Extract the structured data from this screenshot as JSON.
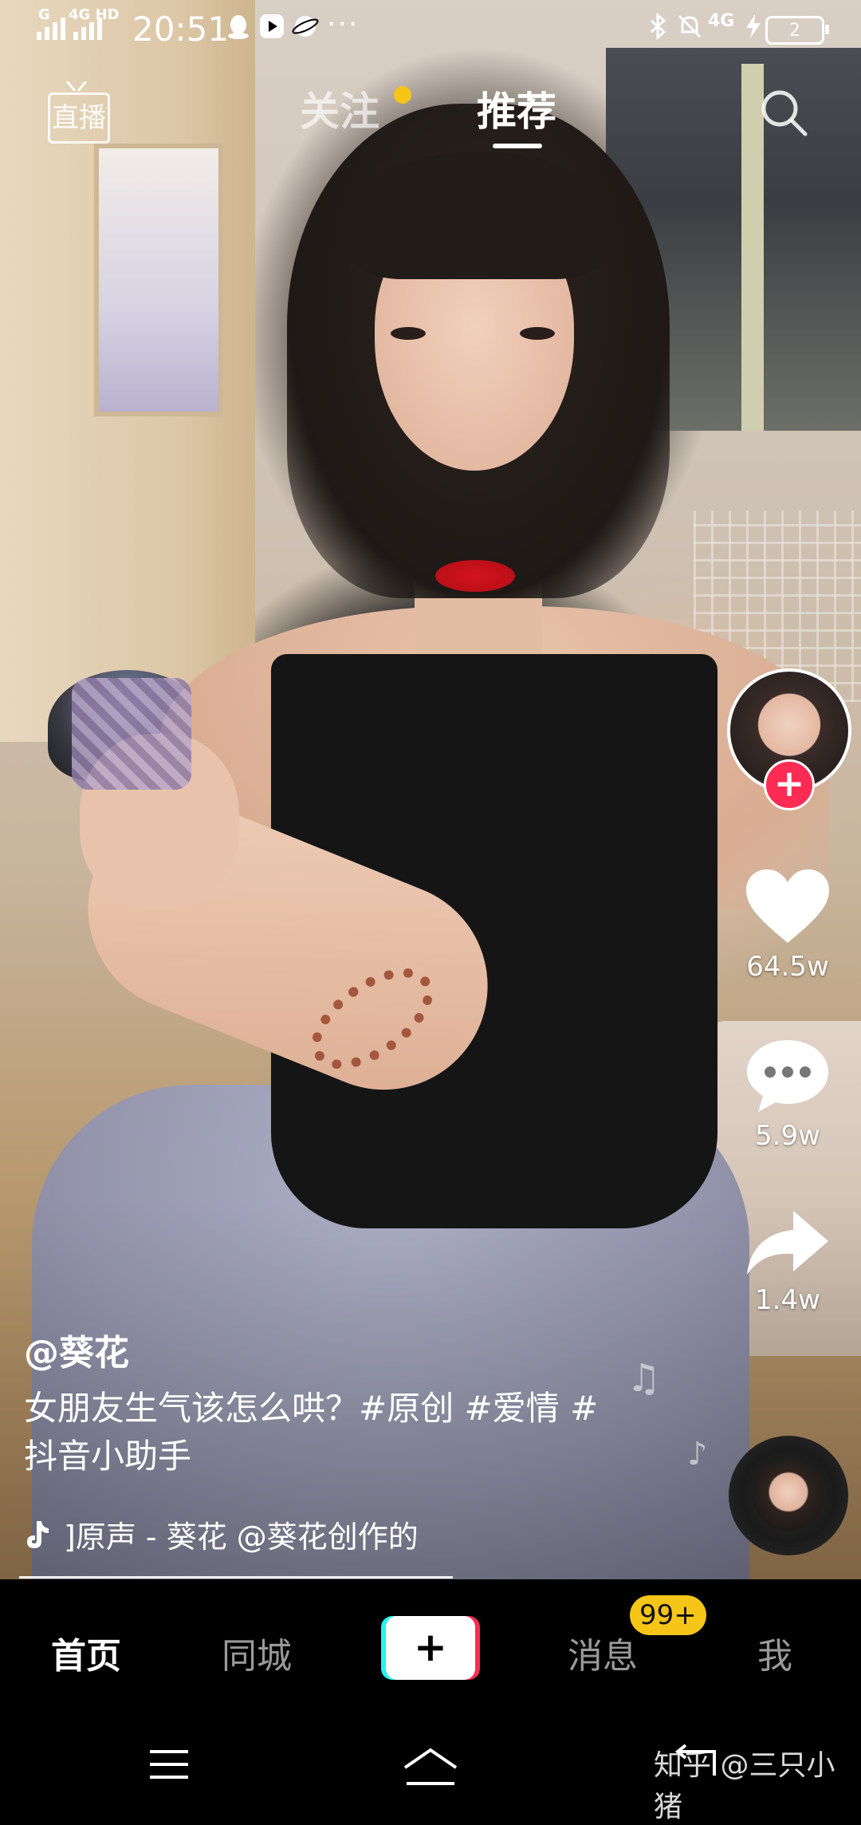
{
  "status_bar": {
    "net1": "G",
    "net2": "4G HD",
    "time": "20:51",
    "dots": "···",
    "net_right": "4G",
    "battery": "2"
  },
  "top_nav": {
    "live_label": "直播",
    "tab_follow": "关注",
    "tab_recommend": "推荐"
  },
  "video": {
    "author": "@葵花",
    "caption": "女朋友生气该怎么哄？#原创 #爱情 #抖音小助手",
    "music": "]原声 - 葵花    @葵花创作的"
  },
  "actions": {
    "likes": "64.5w",
    "comments": "5.9w",
    "shares": "1.4w"
  },
  "tab_bar": {
    "home": "首页",
    "nearby": "同城",
    "create": "+",
    "messages": "消息",
    "messages_badge": "99+",
    "me": "我"
  },
  "watermark": "知乎 @三只小猪",
  "colors": {
    "accent_red": "#fe2c55",
    "accent_cyan": "#25f4ee",
    "badge_yellow": "#f5c518"
  }
}
